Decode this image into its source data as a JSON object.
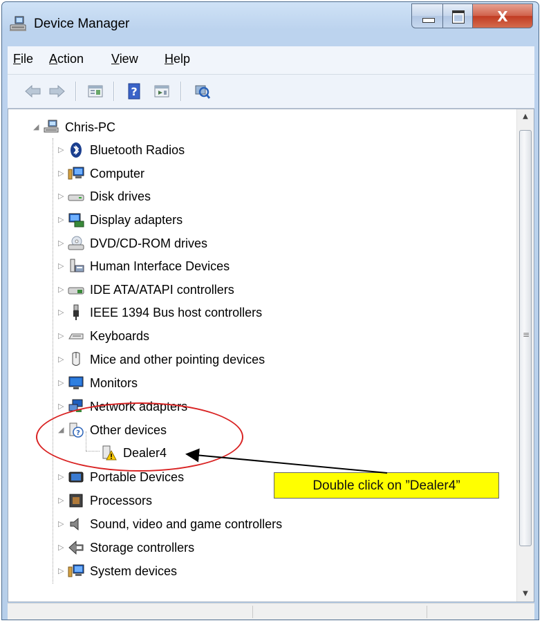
{
  "window": {
    "title": "Device Manager",
    "title_icon": "device-manager-icon",
    "controls": {
      "minimize": "minimize-icon",
      "maximize": "maximize-icon",
      "close": "close-icon",
      "close_glyph": "X"
    }
  },
  "menubar": {
    "items": [
      {
        "label_rest": "ile",
        "mnemonic": "F"
      },
      {
        "label_rest": "ction",
        "mnemonic": "A"
      },
      {
        "label_rest": "iew",
        "mnemonic": "V"
      },
      {
        "label_rest": "elp",
        "mnemonic": "H"
      }
    ]
  },
  "toolbar": {
    "buttons": [
      "back-icon",
      "forward-icon",
      "properties-icon",
      "help-icon",
      "update-driver-icon",
      "scan-hardware-icon"
    ]
  },
  "tree": {
    "root": {
      "label": "Chris-PC",
      "icon": "computer-root-icon",
      "expanded": true
    },
    "items": [
      {
        "label": "Bluetooth Radios",
        "icon": "bluetooth-icon",
        "expanded": false
      },
      {
        "label": "Computer",
        "icon": "computer-icon",
        "expanded": false
      },
      {
        "label": "Disk drives",
        "icon": "disk-drive-icon",
        "expanded": false
      },
      {
        "label": "Display adapters",
        "icon": "display-adapter-icon",
        "expanded": false
      },
      {
        "label": "DVD/CD-ROM drives",
        "icon": "dvd-icon",
        "expanded": false
      },
      {
        "label": "Human Interface Devices",
        "icon": "hid-icon",
        "expanded": false
      },
      {
        "label": "IDE ATA/ATAPI controllers",
        "icon": "ide-icon",
        "expanded": false
      },
      {
        "label": "IEEE 1394 Bus host controllers",
        "icon": "firewire-icon",
        "expanded": false
      },
      {
        "label": "Keyboards",
        "icon": "keyboard-icon",
        "expanded": false
      },
      {
        "label": "Mice and other pointing devices",
        "icon": "mouse-icon",
        "expanded": false
      },
      {
        "label": "Monitors",
        "icon": "monitor-icon",
        "expanded": false
      },
      {
        "label": "Network adapters",
        "icon": "network-icon",
        "expanded": false
      },
      {
        "label": "Other devices",
        "icon": "unknown-device-icon",
        "expanded": true,
        "children": [
          {
            "label": "Dealer4",
            "icon": "warning-device-icon"
          }
        ]
      },
      {
        "label": "Portable Devices",
        "icon": "portable-device-icon",
        "expanded": false
      },
      {
        "label": "Processors",
        "icon": "processor-icon",
        "expanded": false
      },
      {
        "label": "Sound, video and game controllers",
        "icon": "sound-icon",
        "expanded": false
      },
      {
        "label": "Storage controllers",
        "icon": "storage-icon",
        "expanded": false
      },
      {
        "label": "System devices",
        "icon": "system-devices-icon",
        "expanded": false
      }
    ]
  },
  "annotation": {
    "callout_text": "Double click on ”Dealer4”",
    "ellipse_color": "#d92323",
    "callout_color": "#ffff00"
  }
}
